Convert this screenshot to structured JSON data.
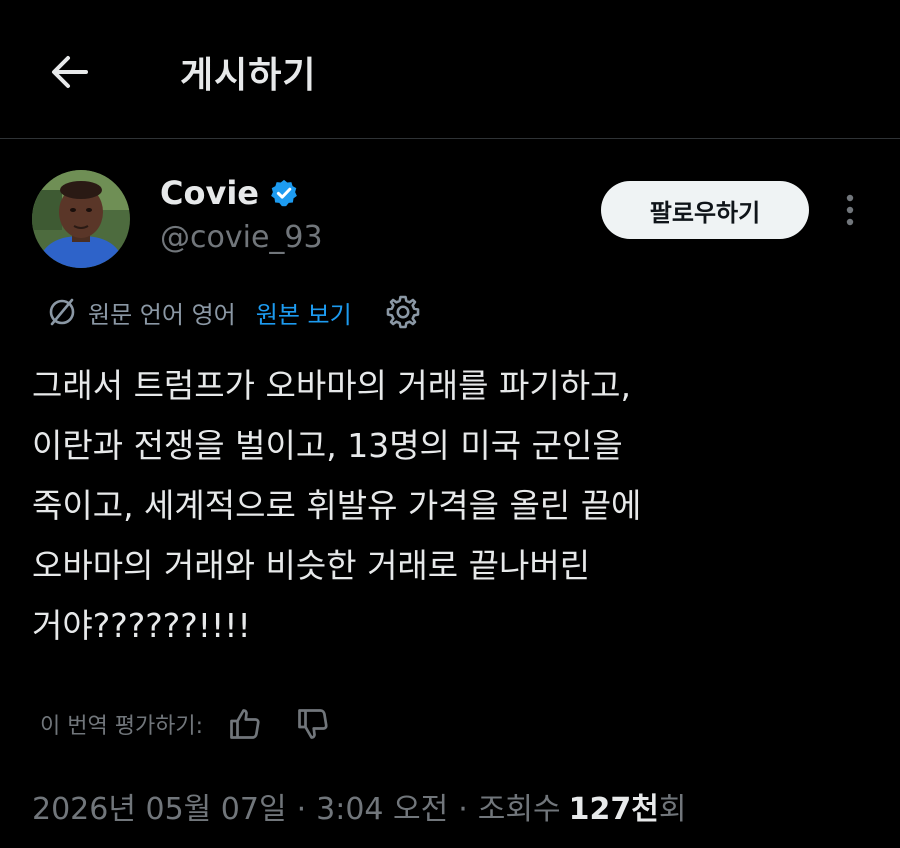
{
  "header": {
    "title": "게시하기",
    "back_icon": "arrow-left-icon"
  },
  "author": {
    "name": "Covie",
    "handle": "@covie_93",
    "verified": true,
    "verified_icon": "verified-badge-icon",
    "verified_color": "#1d9bf0"
  },
  "follow_button": {
    "label": "팔로우하기"
  },
  "more_icon": "more-vertical-icon",
  "translation": {
    "icon": "translate-icon",
    "source_language_text": "원문 언어 영어",
    "show_original_label": "원본 보기",
    "settings_icon": "gear-icon"
  },
  "post": {
    "text": "그래서 트럼프가 오바마의 거래를 파기하고,\n이란과 전쟁을 벌이고, 13명의 미국 군인을\n죽이고, 세계적으로 휘발유 가격을 올린 끝에\n오바마의 거래와 비슷한 거래로 끝나버린\n거야??????!!!!"
  },
  "rating": {
    "label": "이 번역 평가하기:",
    "thumbs_up_icon": "thumbs-up-icon",
    "thumbs_down_icon": "thumbs-down-icon"
  },
  "meta": {
    "date": "2026년 05월 07일",
    "separator": "·",
    "time": "3:04 오전",
    "views_label": "조회수",
    "views_count": "127천",
    "views_suffix": "회"
  },
  "colors": {
    "background": "#000000",
    "text_primary": "#e7e9ea",
    "text_secondary": "#71767b",
    "link": "#1d9bf0",
    "follow_button_bg": "#eff3f4",
    "follow_button_text": "#0f1419"
  }
}
